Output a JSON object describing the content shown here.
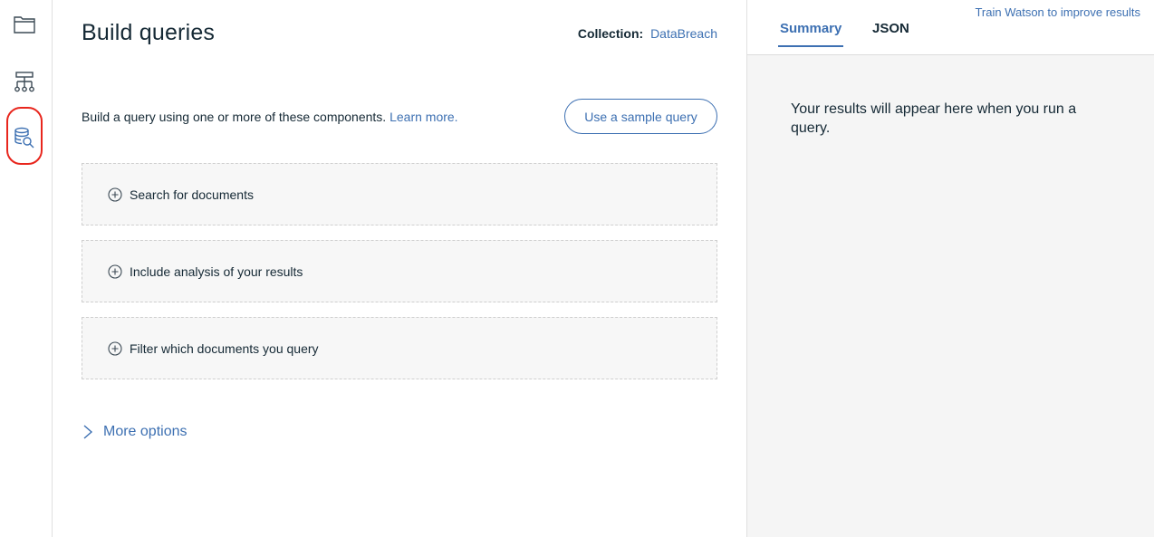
{
  "rail": {
    "items": [
      {
        "icon": "folder-icon"
      },
      {
        "icon": "hierarchy-icon"
      },
      {
        "icon": "database-search-icon",
        "highlighted": true
      }
    ]
  },
  "main": {
    "title": "Build queries",
    "collection_label": "Collection:",
    "collection_value": "DataBreach",
    "intro_text": "Build a query using one or more of these components.",
    "intro_link": "Learn more.",
    "sample_button": "Use a sample query",
    "components": [
      {
        "label": "Search for documents",
        "icon": "plus-circle-icon"
      },
      {
        "label": "Include analysis of your results",
        "icon": "plus-circle-icon"
      },
      {
        "label": "Filter which documents you query",
        "icon": "plus-circle-icon"
      }
    ],
    "more_options": "More options"
  },
  "panel": {
    "train_link": "Train Watson to improve results",
    "tabs": [
      {
        "label": "Summary",
        "active": true
      },
      {
        "label": "JSON",
        "active": false
      }
    ],
    "results_message": "Your results will appear here when you run a query."
  },
  "colors": {
    "accent": "#3d70b2",
    "text": "#152935",
    "highlight_ring": "#e8261d",
    "panel_bg": "#f5f5f5",
    "component_bg": "#f7f7f7"
  }
}
